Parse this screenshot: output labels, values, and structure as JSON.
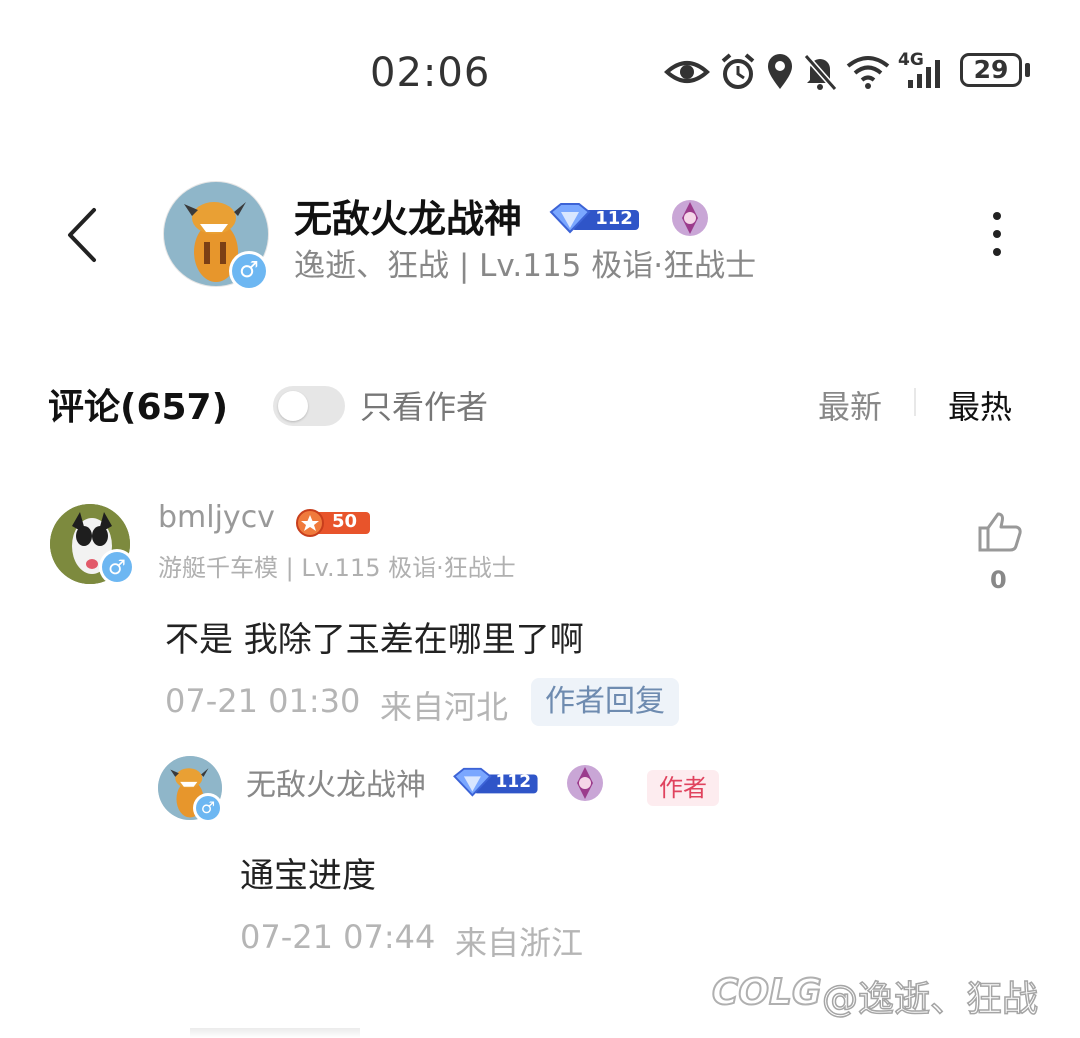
{
  "status_bar": {
    "time": "02:06",
    "battery": "29",
    "network": "4G"
  },
  "header": {
    "name": "无敌火龙战神",
    "level_badge": "112",
    "subtitle": "逸逝、狂战 | Lv.115 极诣·狂战士",
    "gender": "♂"
  },
  "comments_bar": {
    "title": "评论(657)",
    "author_only_label": "只看作者",
    "sort_latest": "最新",
    "sort_hot": "最热"
  },
  "comment": {
    "username": "bmljycv",
    "badge_level": "50",
    "subtitle": "游艇千车模 | Lv.115 极诣·狂战士",
    "text": "不是 我除了玉差在哪里了啊",
    "time": "07-21 01:30",
    "location": "来自河北",
    "author_reply_tag": "作者回复",
    "likes": "0",
    "gender": "♂"
  },
  "reply": {
    "username": "无敌火龙战神",
    "badge_level": "112",
    "author_tag": "作者",
    "text": "通宝进度",
    "time": "07-21 07:44",
    "location": "来自浙江",
    "gender": "♂"
  },
  "watermark": {
    "logo": "COLG",
    "text": "@逸逝、狂战"
  },
  "colors": {
    "gender": "#6db7f2",
    "author_tag": "#e0435e",
    "reply_tag": "#6e8bb0",
    "badge_orange": "#e8542b"
  }
}
